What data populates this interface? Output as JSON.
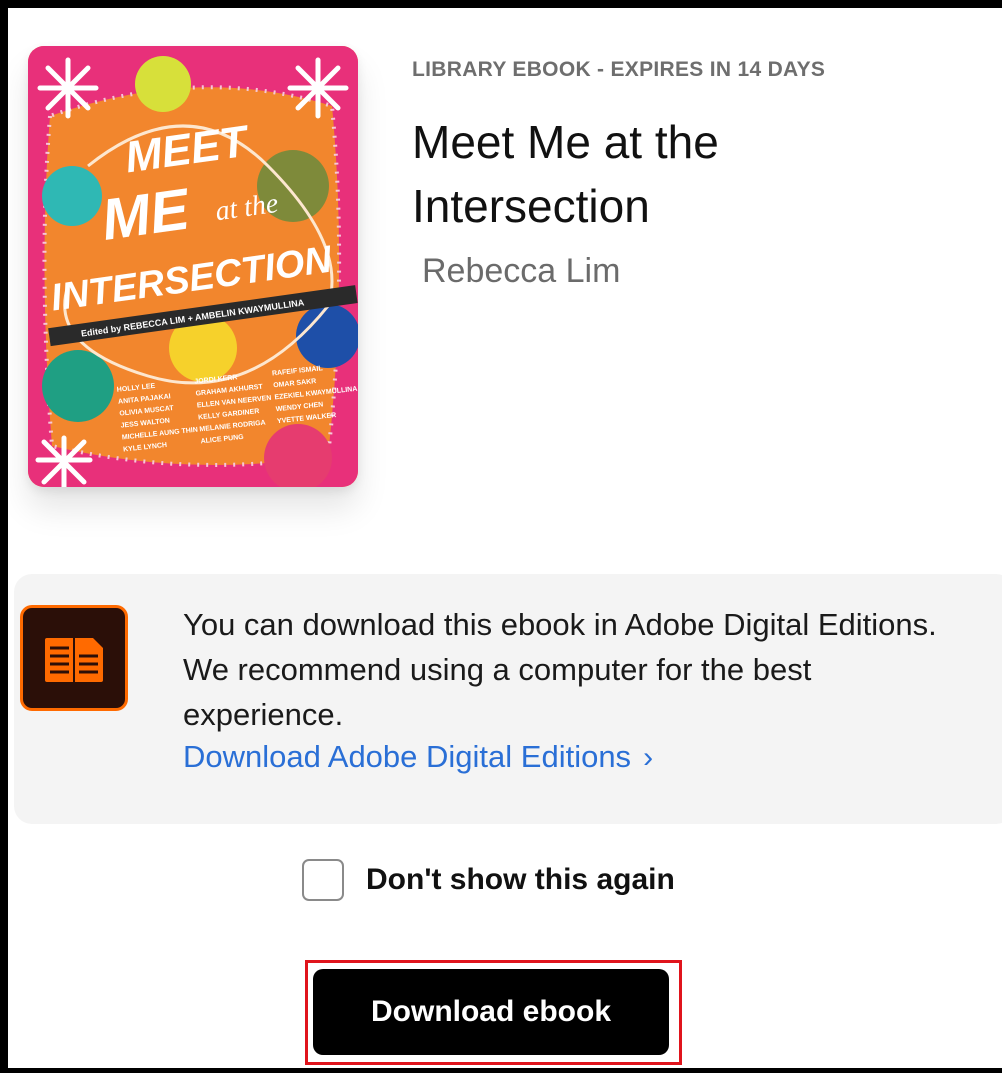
{
  "book": {
    "meta_label": "LIBRARY EBOOK - EXPIRES IN 14 DAYS",
    "title": "Meet Me at the Intersection",
    "author": "Rebecca Lim",
    "cover": {
      "title_line_1": "MEET",
      "title_line_2": "ME",
      "title_at_the": "at the",
      "title_line_3": "INTERSECTION",
      "edited_by": "Edited by REBECCA LIM + AMBELIN KWAYMULLINA",
      "contributors": [
        "HOLLY LEE",
        "JORDI KERR",
        "RAFEIF ISMAIL",
        "ANITA PAJAKAI",
        "GRAHAM AKHURST",
        "OMAR SAKR",
        "OLIVIA MUSCAT",
        "ELLEN VAN NEERVEN",
        "EZEKIEL KWAYMULLINA",
        "JESS WALTON",
        "KELLY GARDINER",
        "WENDY CHEN",
        "MICHELLE AUNG THIN",
        "MELANIE RODRIGA",
        "YVETTE WALKER",
        "KYLE LYNCH",
        "ALICE PUNG"
      ],
      "colors": {
        "background": "#f2862d",
        "border_pink": "#e8307a",
        "white": "#ffffff"
      }
    }
  },
  "notice": {
    "text": "You can download this ebook in Adobe Digital Editions. We recommend using a computer for the best experience.",
    "link_label": "Download Adobe Digital Editions",
    "link_chevron": "›",
    "icon": "adobe-digital-editions-icon"
  },
  "checkbox": {
    "label": "Don't show this again",
    "checked": false
  },
  "download_button": {
    "label": "Download ebook"
  },
  "colors": {
    "link": "#2a6fd6",
    "button_bg": "#000000",
    "highlight": "#e0141c",
    "ade_orange": "#ff6a00"
  }
}
